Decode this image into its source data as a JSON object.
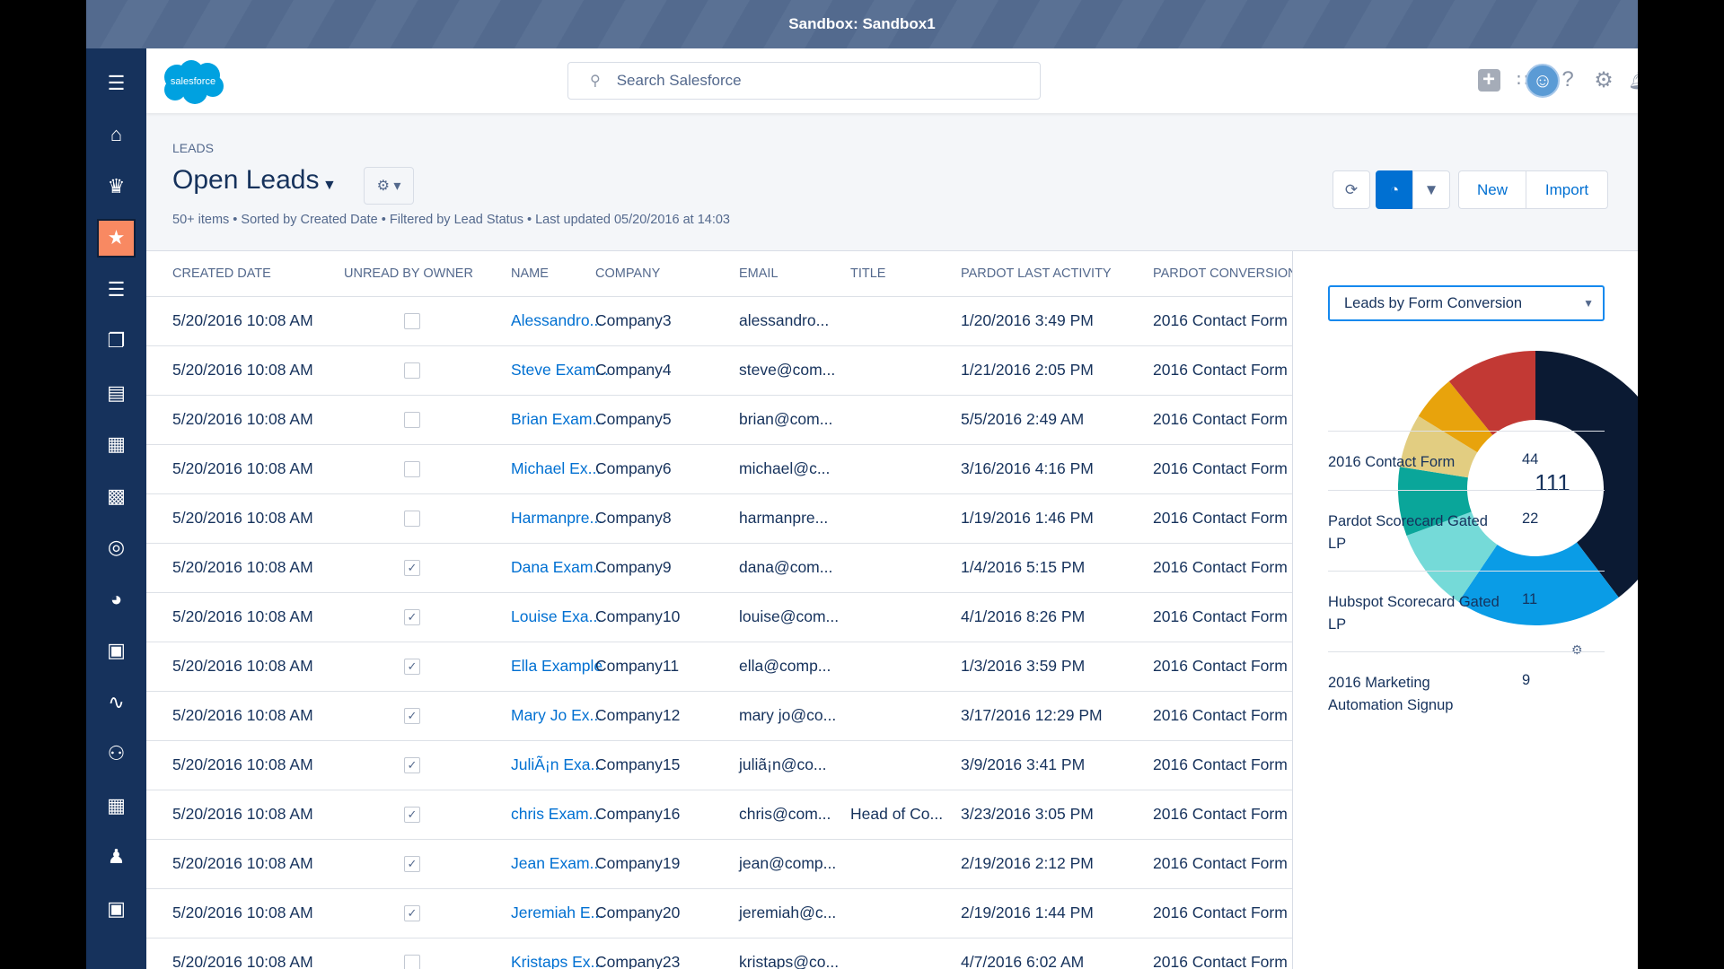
{
  "window": {
    "title": "Sandbox: Sandbox1"
  },
  "header": {
    "logo_text": "salesforce",
    "search_placeholder": "Search Salesforce"
  },
  "sidebar": {
    "items": [
      {
        "icon": "menu-icon"
      },
      {
        "icon": "home-icon"
      },
      {
        "icon": "crown-icon"
      },
      {
        "icon": "leads-star-icon",
        "active": true
      },
      {
        "icon": "task-list-icon"
      },
      {
        "icon": "files-icon"
      },
      {
        "icon": "notes-icon"
      },
      {
        "icon": "building-icon"
      },
      {
        "icon": "contact-card-icon"
      },
      {
        "icon": "target-icon"
      },
      {
        "icon": "dashboard-icon"
      },
      {
        "icon": "clipboard-icon"
      },
      {
        "icon": "pulse-icon"
      },
      {
        "icon": "groups-icon"
      },
      {
        "icon": "calendar-icon"
      },
      {
        "icon": "person-icon"
      },
      {
        "icon": "briefcase-icon"
      }
    ]
  },
  "page": {
    "breadcrumb": "LEADS",
    "title": "Open Leads",
    "meta": "50+ items • Sorted by Created Date • Filtered by Lead Status • Last updated 05/20/2016  at 14:03",
    "new_label": "New",
    "import_label": "Import"
  },
  "table": {
    "columns": [
      "CREATED DATE",
      "UNREAD BY OWNER",
      "NAME",
      "COMPANY",
      "EMAIL",
      "TITLE",
      "PARDOT LAST ACTIVITY",
      "PARDOT CONVERSION"
    ],
    "rows": [
      [
        "5/20/2016 10:08 AM",
        false,
        "Alessandro...",
        "Company3",
        "alessandro...",
        "",
        "1/20/2016 3:49 PM",
        "2016 Contact Form"
      ],
      [
        "5/20/2016 10:08 AM",
        false,
        "Steve Exam...",
        "Company4",
        "steve@com...",
        "",
        "1/21/2016 2:05 PM",
        "2016 Contact Form"
      ],
      [
        "5/20/2016 10:08 AM",
        false,
        "Brian Exam...",
        "Company5",
        "brian@com...",
        "",
        "5/5/2016 2:49 AM",
        "2016 Contact Form"
      ],
      [
        "5/20/2016 10:08 AM",
        false,
        "Michael Ex...",
        "Company6",
        "michael@c...",
        "",
        "3/16/2016 4:16 PM",
        "2016 Contact Form"
      ],
      [
        "5/20/2016 10:08 AM",
        false,
        "Harmanpre...",
        "Company8",
        "harmanpre...",
        "",
        "1/19/2016 1:46 PM",
        "2016 Contact Form"
      ],
      [
        "5/20/2016 10:08 AM",
        true,
        "Dana Exam...",
        "Company9",
        "dana@com...",
        "",
        "1/4/2016 5:15 PM",
        "2016 Contact Form"
      ],
      [
        "5/20/2016 10:08 AM",
        true,
        "Louise Exa...",
        "Company10",
        "louise@com...",
        "",
        "4/1/2016 8:26 PM",
        "2016 Contact Form"
      ],
      [
        "5/20/2016 10:08 AM",
        true,
        "Ella Example",
        "Company11",
        "ella@comp...",
        "",
        "1/3/2016 3:59 PM",
        "2016 Contact Form"
      ],
      [
        "5/20/2016 10:08 AM",
        true,
        "Mary Jo Ex...",
        "Company12",
        "mary jo@co...",
        "",
        "3/17/2016 12:29 PM",
        "2016 Contact Form"
      ],
      [
        "5/20/2016 10:08 AM",
        true,
        "JuliÃ¡n Exa...",
        "Company15",
        "juliã¡n@co...",
        "",
        "3/9/2016 3:41 PM",
        "2016 Contact Form"
      ],
      [
        "5/20/2016 10:08 AM",
        true,
        "chris Exam...",
        "Company16",
        "chris@com...",
        "Head of Co...",
        "3/23/2016 3:05 PM",
        "2016 Contact Form"
      ],
      [
        "5/20/2016 10:08 AM",
        true,
        "Jean Exam...",
        "Company19",
        "jean@comp...",
        "",
        "2/19/2016 2:12 PM",
        "2016 Contact Form"
      ],
      [
        "5/20/2016 10:08 AM",
        true,
        "Jeremiah E...",
        "Company20",
        "jeremiah@c...",
        "",
        "2/19/2016 1:44 PM",
        "2016 Contact Form"
      ],
      [
        "5/20/2016 10:08 AM",
        false,
        "Kristaps Ex...",
        "Company23",
        "kristaps@co...",
        "",
        "4/7/2016 6:02 AM",
        "2016 Contact Form"
      ]
    ]
  },
  "panel": {
    "dropdown_value": "Leads by Form Conversion"
  },
  "chart_data": {
    "type": "pie",
    "donut": true,
    "total_label": "111",
    "slices": [
      {
        "name": "2016 Contact Form",
        "value": 44,
        "color": "#0b1a33"
      },
      {
        "name": "Pardot Scorecard Gated LP",
        "value": 22,
        "color": "#0a9ce6"
      },
      {
        "name": "Hubspot Scorecard Gated LP",
        "value": 11,
        "color": "#75dad8"
      },
      {
        "name": "2016 Marketing Automation Signup",
        "value": 9,
        "color": "#0aa69a"
      },
      {
        "value": 7,
        "color": "#e2cd81"
      },
      {
        "value": 6,
        "color": "#e8a30c"
      },
      {
        "value": 12,
        "color": "#c23934"
      }
    ]
  }
}
